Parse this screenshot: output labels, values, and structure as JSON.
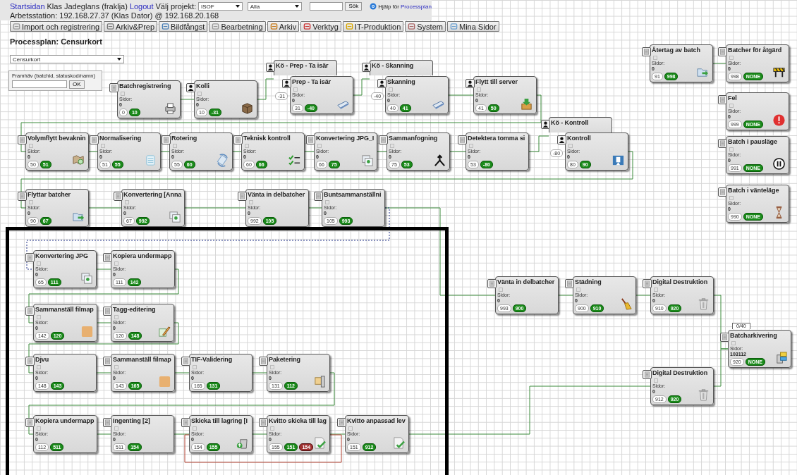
{
  "topbar": {
    "home_link": "Startsidan",
    "user": "Klas Jadeglans (fraklja)",
    "logout_link": "Logout",
    "project_label": "Välj projekt:",
    "project_select": "ISOF",
    "filter_select": "Alla",
    "search_button": "Sök",
    "help_text": "Hjälp för",
    "help_link": "Processplan",
    "workstation": "Arbetsstation: 192.168.27.37 (Klas Dator) @ 192.168.20.168"
  },
  "menu_tabs": [
    {
      "label": "Import och registrering",
      "selected": false
    },
    {
      "label": "Arkiv&Prep",
      "selected": false
    },
    {
      "label": "Bildfångst",
      "selected": false
    },
    {
      "label": "Bearbetning",
      "selected": false
    },
    {
      "label": "Arkiv",
      "selected": false
    },
    {
      "label": "Verktyg",
      "selected": false
    },
    {
      "label": "IT-Produktion",
      "selected": false
    },
    {
      "label": "System",
      "selected": false
    },
    {
      "label": "Mina Sidor",
      "selected": false
    }
  ],
  "page_title": "Processplan: Censurkort",
  "plan_select": "Censurkort",
  "highlight": {
    "label": "Framhäv (batchid, statuskod/namn)",
    "button": "OK"
  },
  "nodes": [
    {
      "title": "Batchregistrering",
      "kind": "step",
      "pages_label": "Sidor:",
      "pages": "0",
      "in": "0",
      "out": "10"
    },
    {
      "title": "Kolli",
      "kind": "person",
      "pages_label": "Sidor:",
      "pages": "0",
      "in": "10",
      "out": "-31"
    },
    {
      "title": "Kö - Prep - Ta isär",
      "kind": "queue",
      "in": "-31"
    },
    {
      "title": "Prep - Ta isär",
      "kind": "person",
      "pages_label": "Sidor:",
      "pages": "0",
      "in": "31",
      "out": "-40"
    },
    {
      "title": "Kö - Skanning",
      "kind": "queue",
      "in": "-40"
    },
    {
      "title": "Skanning",
      "kind": "person",
      "pages_label": "Sidor:",
      "pages": "0",
      "in": "40",
      "out": "41"
    },
    {
      "title": "Flytt till server",
      "kind": "person",
      "pages_label": "Sidor:",
      "pages": "0",
      "in": "41",
      "out": "50"
    },
    {
      "title": "Återtag av batch",
      "kind": "step",
      "pages_label": "Sidor:",
      "pages": "0",
      "in": "91",
      "out": "998"
    },
    {
      "title": "Batcher för åtgärd",
      "kind": "step",
      "pages_label": "Sidor:",
      "pages": "0",
      "in": "998",
      "out": "NONE"
    },
    {
      "title": "Fel",
      "kind": "step",
      "pages_label": "Sidor:",
      "pages": "0",
      "in": "999",
      "out": "NONE"
    },
    {
      "title": "Batch i pausläge",
      "kind": "step",
      "pages_label": "Sidor:",
      "pages": "0",
      "in": "991",
      "out": "NONE"
    },
    {
      "title": "Batch i vänteläge",
      "kind": "step",
      "pages_label": "Sidor:",
      "pages": "0",
      "in": "990",
      "out": "NONE"
    },
    {
      "title": "Volymflytt bevaknin",
      "kind": "step",
      "pages_label": "Sidor:",
      "pages": "0",
      "in": "50",
      "out": "51"
    },
    {
      "title": "Normalisering",
      "kind": "step",
      "pages_label": "Sidor:",
      "pages": "0",
      "in": "51",
      "out": "55"
    },
    {
      "title": "Rotering",
      "kind": "step",
      "pages_label": "Sidor:",
      "pages": "0",
      "in": "55",
      "out": "60"
    },
    {
      "title": "Teknisk kontroll",
      "kind": "step",
      "pages_label": "Sidor:",
      "pages": "0",
      "in": "60",
      "out": "66"
    },
    {
      "title": "Konvertering JPG_I",
      "kind": "step",
      "pages_label": "Sidor:",
      "pages": "0",
      "in": "66",
      "out": "75"
    },
    {
      "title": "Sammanfogning",
      "kind": "step",
      "pages_label": "Sidor:",
      "pages": "0",
      "in": "75",
      "out": "53"
    },
    {
      "title": "Detektera tomma si",
      "kind": "step",
      "pages_label": "Sidor:",
      "pages": "0",
      "in": "53",
      "out": "-80"
    },
    {
      "title": "Kö - Kontroll",
      "kind": "queue",
      "in": "-80"
    },
    {
      "title": "Kontroll",
      "kind": "person",
      "pages_label": "Sidor:",
      "pages": "0",
      "in": "80",
      "out": "90"
    },
    {
      "title": "Flyttar batcher",
      "kind": "step",
      "pages_label": "Sidor:",
      "pages": "0",
      "in": "90",
      "out": "67"
    },
    {
      "title": "Konvertering [Anna",
      "kind": "step",
      "pages_label": "Sidor:",
      "pages": "0",
      "in": "67",
      "out": "992"
    },
    {
      "title": "Vänta in delbatcher",
      "kind": "step",
      "pages_label": "Sidor:",
      "pages": "0",
      "in": "992",
      "out": "105"
    },
    {
      "title": "Buntsammanställni",
      "kind": "step",
      "pages_label": "Sidor:",
      "pages": "0",
      "in": "105",
      "out": "993"
    },
    {
      "title": "Konvertering JPG",
      "kind": "step",
      "pages_label": "Sidor:",
      "pages": "0",
      "in": "65",
      "out": "111"
    },
    {
      "title": "Kopiera undermapp",
      "kind": "step",
      "pages_label": "Sidor:",
      "pages": "0",
      "in": "111",
      "out": "142"
    },
    {
      "title": "Sammanställ filmap",
      "kind": "step",
      "pages_label": "Sidor:",
      "pages": "0",
      "in": "142",
      "out": "120"
    },
    {
      "title": "Tagg-editering",
      "kind": "step",
      "pages_label": "Sidor:",
      "pages": "0",
      "in": "120",
      "out": "148"
    },
    {
      "title": "Djvu",
      "kind": "step",
      "pages_label": "Sidor:",
      "pages": "0",
      "in": "148",
      "out": "143"
    },
    {
      "title": "Sammanställ filmap",
      "kind": "step",
      "pages_label": "Sidor:",
      "pages": "0",
      "in": "143",
      "out": "165"
    },
    {
      "title": "TIF-Validering",
      "kind": "step",
      "pages_label": "Sidor:",
      "pages": "0",
      "in": "165",
      "out": "131"
    },
    {
      "title": "Paketering",
      "kind": "step",
      "pages_label": "Sidor:",
      "pages": "0",
      "in": "131",
      "out": "112"
    },
    {
      "title": "Kopiera undermapp",
      "kind": "step",
      "pages_label": "Sidor:",
      "pages": "0",
      "in": "112",
      "out": "511"
    },
    {
      "title": "Ingenting [2]",
      "kind": "step",
      "pages_label": "Sidor:",
      "pages": "0",
      "in": "511",
      "out": "154"
    },
    {
      "title": "Skicka till lagring [I",
      "kind": "step",
      "pages_label": "Sidor:",
      "pages": "0",
      "in": "154",
      "out": "155"
    },
    {
      "title": "Kvitto skicka till lag",
      "kind": "step",
      "pages_label": "Sidor:",
      "pages": "0",
      "in": "155",
      "out": "151",
      "alert": "154"
    },
    {
      "title": "Kvitto anpassad lev",
      "kind": "step",
      "pages_label": "Sidor:",
      "pages": "0",
      "in": "151",
      "out": "912"
    },
    {
      "title": "Vänta in delbatcher",
      "kind": "step",
      "pages_label": "Sidor:",
      "pages": "0",
      "in": "993",
      "out": "900"
    },
    {
      "title": "Städning",
      "kind": "step",
      "pages_label": "Sidor:",
      "pages": "0",
      "in": "900",
      "out": "910"
    },
    {
      "title": "Digital Destruktion",
      "kind": "step",
      "pages_label": "Sidor:",
      "pages": "0",
      "in": "910",
      "out": "920"
    },
    {
      "title": "Batcharkivering",
      "kind": "step",
      "counter": "0/40",
      "pages_label": "Sidor:",
      "pages": "103112",
      "in": "920",
      "out": "NONE"
    },
    {
      "title": "Digital Destruktion",
      "kind": "step",
      "pages_label": "Sidor:",
      "pages": "0",
      "in": "912",
      "out": "920"
    }
  ]
}
